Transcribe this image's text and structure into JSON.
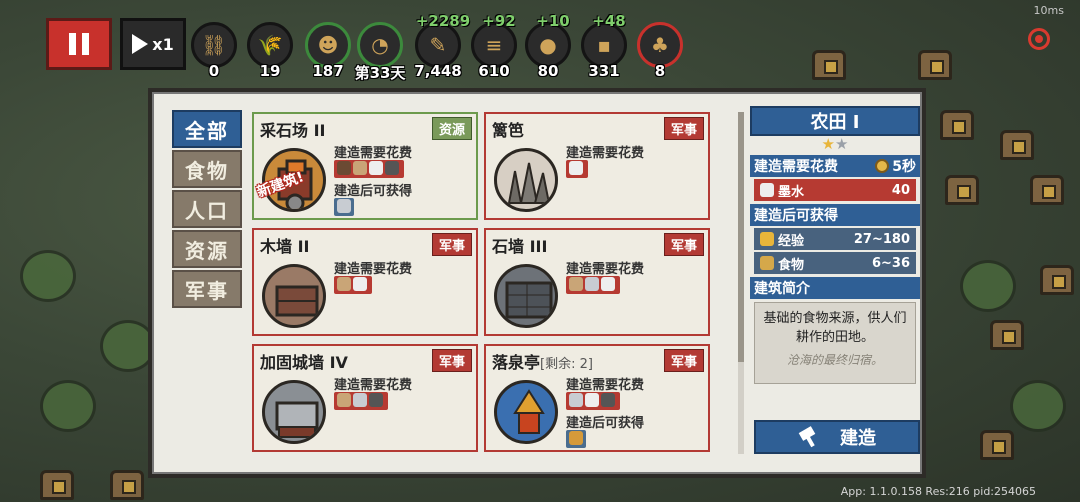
{
  "hud": {
    "pause_icon": "pause-icon",
    "speed_label": "x1",
    "resources": [
      {
        "name": "chain-icon",
        "value": "0",
        "delta": ""
      },
      {
        "name": "wheat-icon",
        "value": "19",
        "delta": ""
      },
      {
        "name": "population-icon",
        "value": "187",
        "delta": ""
      },
      {
        "name": "day-clock-icon",
        "value": "第33天",
        "delta": ""
      },
      {
        "name": "ink-brush-icon",
        "value": "7,448",
        "delta": "+2289"
      },
      {
        "name": "wood-icon",
        "value": "610",
        "delta": "+92"
      },
      {
        "name": "ore-icon",
        "value": "80",
        "delta": "+10"
      },
      {
        "name": "stone-icon",
        "value": "331",
        "delta": "+48"
      },
      {
        "name": "clover-icon",
        "value": "8",
        "delta": ""
      }
    ],
    "fps": "10ms"
  },
  "categories": [
    "全部",
    "食物",
    "人口",
    "资源",
    "军事"
  ],
  "active_category": "全部",
  "cards": [
    {
      "title": "采石场 II",
      "remaining": "",
      "tag": "资源",
      "cost_label": "建造需要花费",
      "gain_label": "建造后可获得",
      "new_badge": "新建筑!"
    },
    {
      "title": "篱笆",
      "remaining": "",
      "tag": "军事",
      "cost_label": "建造需要花费",
      "gain_label": "",
      "new_badge": ""
    },
    {
      "title": "木墙 II",
      "remaining": "",
      "tag": "军事",
      "cost_label": "建造需要花费",
      "gain_label": "",
      "new_badge": ""
    },
    {
      "title": "石墙 III",
      "remaining": "",
      "tag": "军事",
      "cost_label": "建造需要花费",
      "gain_label": "",
      "new_badge": ""
    },
    {
      "title": "加固城墙 IV",
      "remaining": "",
      "tag": "军事",
      "cost_label": "建造需要花费",
      "gain_label": "",
      "new_badge": ""
    },
    {
      "title": "落泉亭",
      "remaining": "[剩余: 2]",
      "tag": "军事",
      "cost_label": "建造需要花费",
      "gain_label": "建造后可获得",
      "new_badge": ""
    }
  ],
  "detail": {
    "title": "农田 I",
    "stars_filled": 1,
    "stars_total": 2,
    "cost_header": "建造需要花费",
    "build_time": "5秒",
    "costs": [
      {
        "icon": "ink-brush-icon",
        "name": "墨水",
        "value": "40"
      }
    ],
    "gain_header": "建造后可获得",
    "gains": [
      {
        "icon": "star-icon",
        "name": "经验",
        "value": "27~180"
      },
      {
        "icon": "wheat-icon",
        "name": "食物",
        "value": "6~36"
      }
    ],
    "intro_header": "建筑简介",
    "intro_text": "基础的食物来源，供人们耕作的田地。",
    "flavor_text": "沧海的最终归宿。",
    "build_button": "建造"
  },
  "app_info": "App: 1.1.0.158 Res:216 pid:254065",
  "colors": {
    "accent_blue": "#2f5f95",
    "military_red": "#b33a34",
    "resource_green": "#7a9a5a"
  }
}
